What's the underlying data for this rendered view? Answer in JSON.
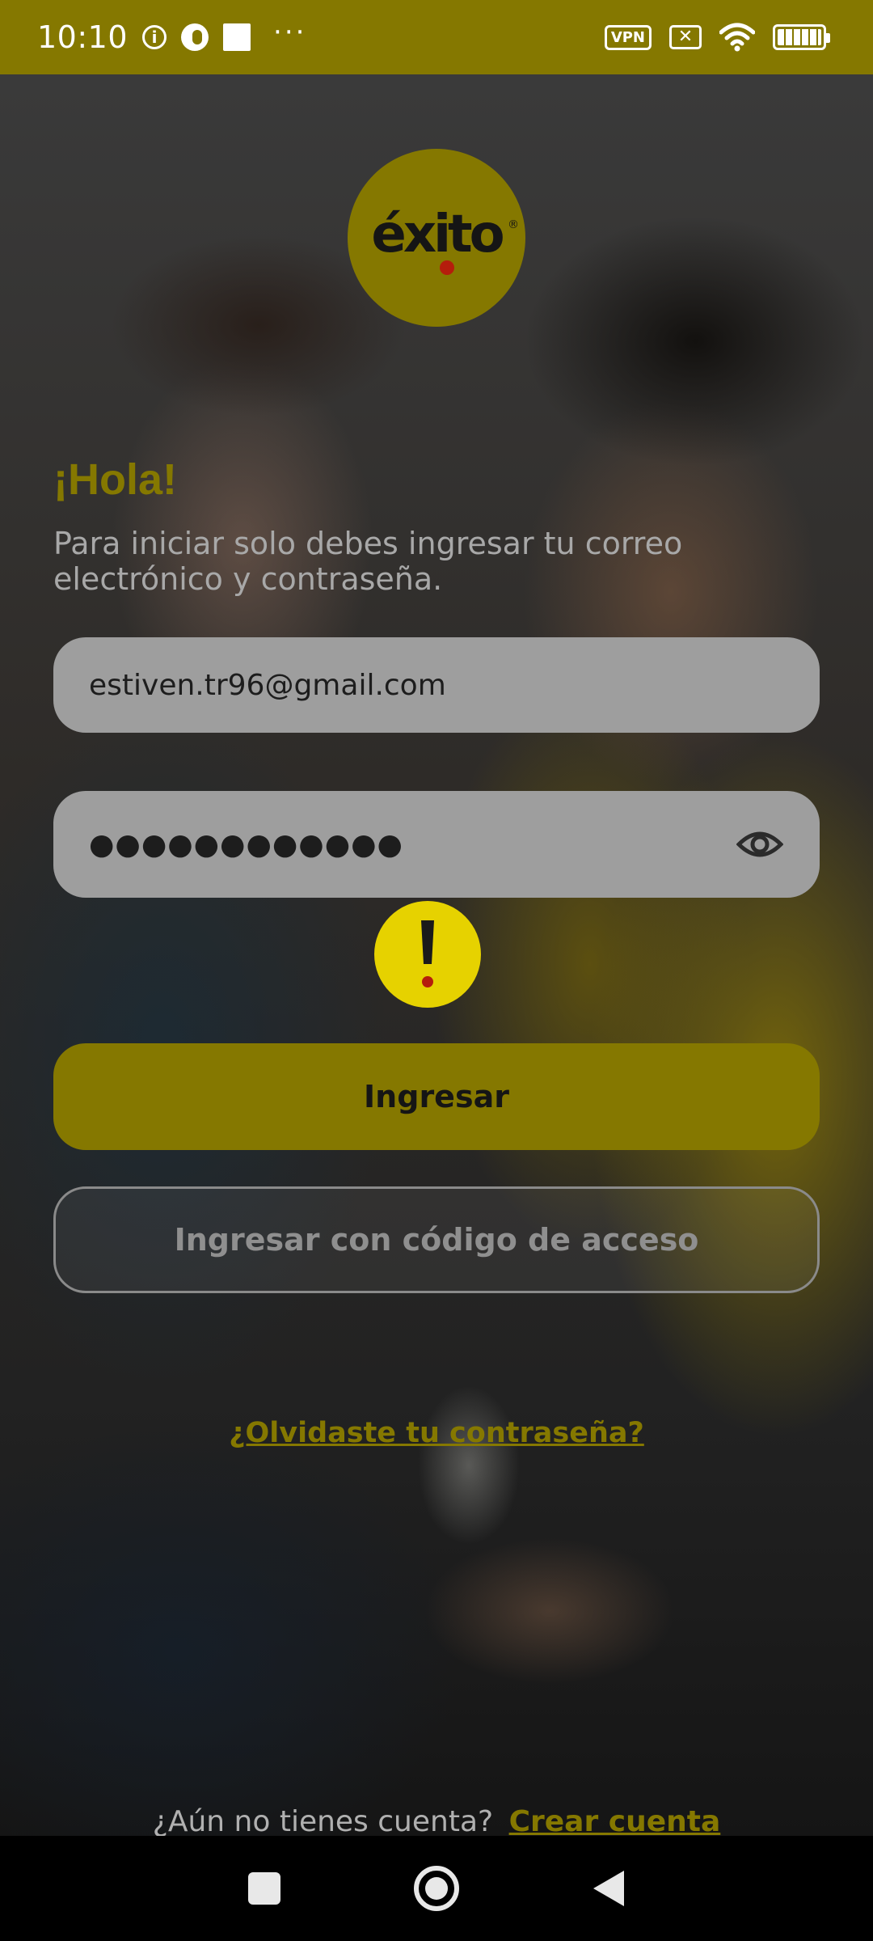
{
  "status_bar": {
    "time": "10:10",
    "vpn_label": "VPN",
    "dots": "···",
    "x_box": "✕"
  },
  "brand": {
    "logo_text": "éxito",
    "logo_registered": "®",
    "accent_color": "#857800",
    "warning_color": "#e6d200"
  },
  "login": {
    "greeting": "¡Hola!",
    "subtitle": "Para iniciar solo debes ingresar tu correo electrónico y contraseña.",
    "email_value": "estiven.tr96@gmail.com",
    "password_value": "●●●●●●●●●●●●",
    "submit_label": "Ingresar",
    "access_code_label": "Ingresar con código de acceso",
    "forgot_label": "¿Olvidaste tu contraseña?",
    "no_account_text": "¿Aún no tienes cuenta?",
    "create_account_label": "Crear cuenta"
  },
  "icons": {
    "info": "info-icon",
    "eye": "eye-icon",
    "warning": "warning-icon",
    "nav_recents": "square-icon",
    "nav_home": "circle-icon",
    "nav_back": "triangle-back-icon"
  }
}
